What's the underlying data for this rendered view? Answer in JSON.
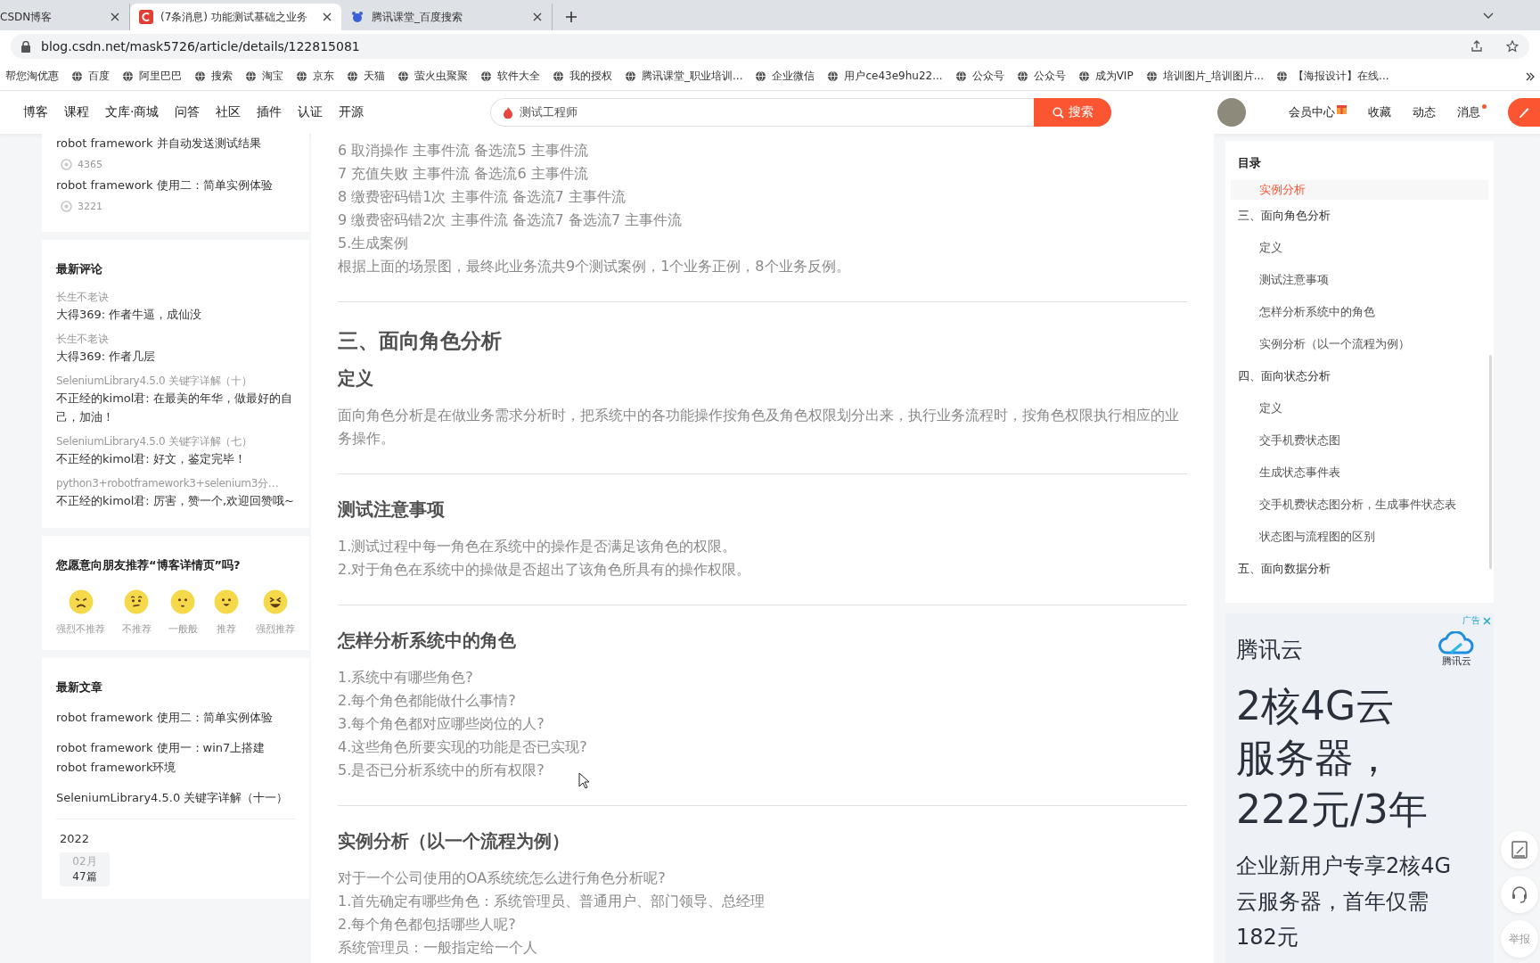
{
  "browser": {
    "tabs": [
      {
        "title": "CSDN博客",
        "selected": false
      },
      {
        "title": "(7条消息) 功能测试基础之业务",
        "selected": true
      },
      {
        "title": "腾讯课堂_百度搜索",
        "selected": false
      }
    ],
    "address": "blog.csdn.net/mask5726/article/details/122815081",
    "bookmarks": [
      "帮您淘优惠",
      "百度",
      "阿里巴巴",
      "搜索",
      "淘宝",
      "京东",
      "天猫",
      "萤火虫聚聚",
      "软件大全",
      "我的授权",
      "腾讯课堂_职业培训...",
      "企业微信",
      "用户ce43e9hu22...",
      "公众号",
      "公众号",
      "成为VIP",
      "培训图片_培训图片...",
      "【海报设计】在线..."
    ]
  },
  "site_nav": {
    "items": [
      "博客",
      "课程",
      "文库·商城",
      "问答",
      "社区",
      "插件",
      "认证",
      "开源"
    ],
    "search_value": "测试工程师",
    "search_button": "搜索",
    "right_items": [
      {
        "label": "会员中心",
        "badge": true
      },
      {
        "label": "收藏",
        "badge": false
      },
      {
        "label": "动态",
        "badge": false
      },
      {
        "label": "消息",
        "badge": true
      }
    ]
  },
  "left_sidebar": {
    "top_articles": [
      {
        "title": "robot framework 并自动发送测试结果",
        "views": "4365"
      },
      {
        "title": "robot framework 使用二：简单实例体验",
        "views": "3221"
      }
    ],
    "recent_comments": {
      "title": "最新评论",
      "items": [
        {
          "article": "长生不老诀",
          "comment": "大得369: 作者牛逼，成仙没"
        },
        {
          "article": "长生不老诀",
          "comment": "大得369: 作者几层"
        },
        {
          "article": "SeleniumLibrary4.5.0 关键字详解（十）",
          "comment": "不正经的kimol君: 在最美的年华，做最好的自己，加油！"
        },
        {
          "article": "SeleniumLibrary4.5.0 关键字详解（七）",
          "comment": "不正经的kimol君: 好文，鉴定完毕！"
        },
        {
          "article": "python3+robotframework3+selenium3分…",
          "comment": "不正经的kimol君: 厉害，赞一个,欢迎回赞哦~"
        }
      ]
    },
    "recommend": {
      "question": "您愿意向朋友推荐“博客详情页”吗?",
      "options": [
        {
          "label": "强烈不推荐",
          "kind": "angry"
        },
        {
          "label": "不推荐",
          "kind": "unsure"
        },
        {
          "label": "一般般",
          "kind": "neutral"
        },
        {
          "label": "推荐",
          "kind": "happy"
        },
        {
          "label": "强烈推荐",
          "kind": "laugh"
        }
      ]
    },
    "recent_articles": {
      "title": "最新文章",
      "items": [
        "robot framework 使用二：简单实例体验",
        "robot framework 使用一：win7上搭建robot framework环境",
        "SeleniumLibrary4.5.0 关键字详解（十一）"
      ]
    },
    "archive": {
      "year": "2022",
      "months": [
        {
          "month": "02月",
          "count": "47篇"
        }
      ]
    }
  },
  "article": [
    {
      "kind": "line",
      "text": "6 取消操作 主事件流 备选流5 主事件流"
    },
    {
      "kind": "line",
      "text": "7 充值失败 主事件流 备选流6 主事件流"
    },
    {
      "kind": "line",
      "text": "8 缴费密码错1次 主事件流 备选流7 主事件流"
    },
    {
      "kind": "line",
      "text": "9 缴费密码错2次 主事件流 备选流7 备选流7 主事件流"
    },
    {
      "kind": "line",
      "text": "5.生成案例"
    },
    {
      "kind": "line",
      "text": "根据上面的场景图，最终此业务流共9个测试案例，1个业务正例，8个业务反例。"
    },
    {
      "kind": "rule"
    },
    {
      "kind": "h2",
      "text": "三、面向角色分析"
    },
    {
      "kind": "h3",
      "text": "定义"
    },
    {
      "kind": "line",
      "text": "面向角色分析是在做业务需求分析时，把系统中的各功能操作按角色及角色权限划分出来，执行业务流程时，按角色权限执行相应的业务操作。"
    },
    {
      "kind": "rule"
    },
    {
      "kind": "h3",
      "text": "测试注意事项"
    },
    {
      "kind": "line",
      "text": "1.测试过程中每一角色在系统中的操作是否满足该角色的权限。"
    },
    {
      "kind": "line",
      "text": "2.对于角色在系统中的操做是否超出了该角色所具有的操作权限。"
    },
    {
      "kind": "rule"
    },
    {
      "kind": "h3",
      "text": "怎样分析系统中的角色"
    },
    {
      "kind": "line",
      "text": "1.系统中有哪些角色?"
    },
    {
      "kind": "line",
      "text": "2.每个角色都能做什么事情?"
    },
    {
      "kind": "line",
      "text": "3.每个角色都对应哪些岗位的人?"
    },
    {
      "kind": "line",
      "text": "4.这些角色所要实现的功能是否已实现?"
    },
    {
      "kind": "line",
      "text": "5.是否已分析系统中的所有权限?"
    },
    {
      "kind": "rule"
    },
    {
      "kind": "h3",
      "text": "实例分析（以一个流程为例）"
    },
    {
      "kind": "line",
      "text": "对于一个公司使用的OA系统统怎么进行角色分析呢?"
    },
    {
      "kind": "line",
      "text": "1.首先确定有哪些角色：系统管理员、普通用户、部门领导、总经理"
    },
    {
      "kind": "line",
      "text": "2.每个角色都包括哪些人呢?"
    },
    {
      "kind": "line",
      "text": "系统管理员：一般指定给一个人"
    }
  ],
  "toc": {
    "title": "目录",
    "leading_children": [
      {
        "label": "实例分析",
        "selected": true
      }
    ],
    "items": [
      {
        "label": "三、面向角色分析",
        "selected": false,
        "children": [
          {
            "label": "定义",
            "selected": false
          },
          {
            "label": "测试注意事项",
            "selected": false
          },
          {
            "label": "怎样分析系统中的角色",
            "selected": false
          },
          {
            "label": "实例分析（以一个流程为例）",
            "selected": false
          }
        ]
      },
      {
        "label": "四、面向状态分析",
        "selected": false,
        "children": [
          {
            "label": "定义",
            "selected": false
          },
          {
            "label": "交手机费状态图",
            "selected": false
          },
          {
            "label": "生成状态事件表",
            "selected": false
          },
          {
            "label": "交手机费状态图分析，生成事件状态表",
            "selected": false
          },
          {
            "label": "状态图与流程图的区别",
            "selected": false
          }
        ]
      },
      {
        "label": "五、面向数据分析",
        "selected": false
      }
    ]
  },
  "ad": {
    "badge": "广告",
    "brand": "腾讯云",
    "logo_caption": "腾讯云",
    "headline": [
      "2核4G云",
      "服务器，",
      "222元/3年"
    ],
    "subline": [
      "企业新用户专享2核4G",
      "云服务器，首年仅需",
      "182元"
    ]
  },
  "float_buttons": {
    "report": "举报"
  }
}
